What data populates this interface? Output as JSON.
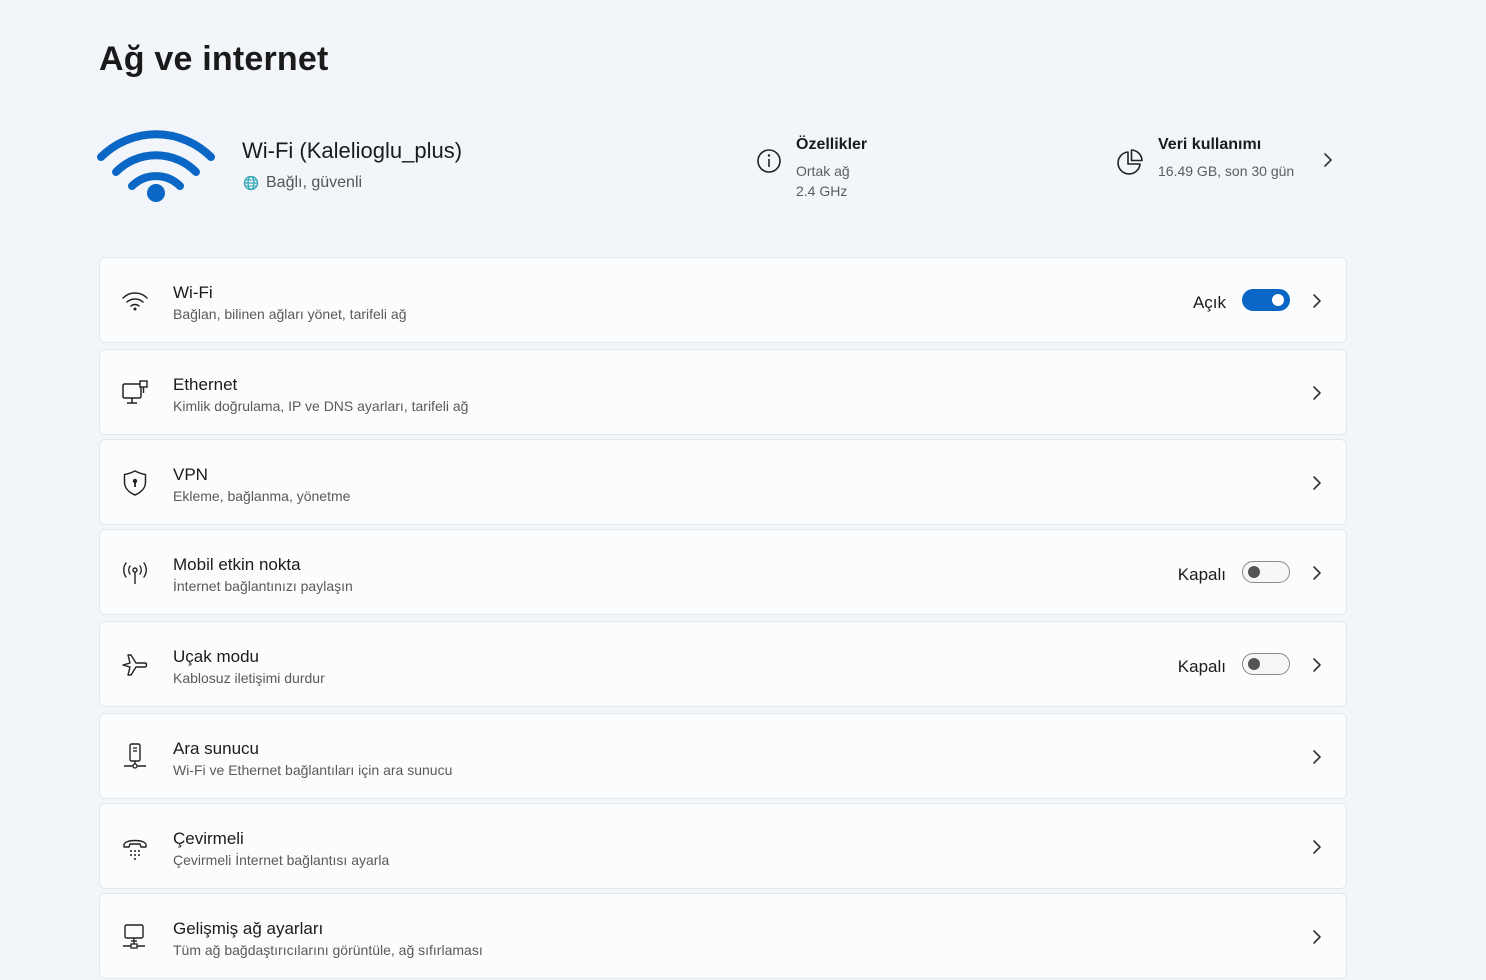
{
  "page": {
    "title": "Ağ ve internet"
  },
  "hero": {
    "network_name": "Wi-Fi (Kalelioglu_plus)",
    "status": "Bağlı, güvenli",
    "properties": {
      "title": "Özellikler",
      "line1": "Ortak ağ",
      "line2": "2.4 GHz"
    },
    "usage": {
      "title": "Veri kullanımı",
      "value": "16.49 GB, son 30 gün"
    }
  },
  "items": [
    {
      "title": "Wi-Fi",
      "subtitle": "Bağlan, bilinen ağları yönet, tarifeli ağ",
      "state": "Açık",
      "icon": "wifi-icon"
    },
    {
      "title": "Ethernet",
      "subtitle": "Kimlik doğrulama, IP ve DNS ayarları, tarifeli ağ",
      "icon": "ethernet-icon"
    },
    {
      "title": "VPN",
      "subtitle": "Ekleme, bağlanma, yönetme",
      "icon": "shield-icon"
    },
    {
      "title": "Mobil etkin nokta",
      "subtitle": "İnternet bağlantınızı paylaşın",
      "state": "Kapalı",
      "icon": "hotspot-icon"
    },
    {
      "title": "Uçak modu",
      "subtitle": "Kablosuz iletişimi durdur",
      "state": "Kapalı",
      "icon": "airplane-icon"
    },
    {
      "title": "Ara sunucu",
      "subtitle": "Wi-Fi ve Ethernet bağlantıları için ara sunucu",
      "icon": "proxy-icon"
    },
    {
      "title": "Çevirmeli",
      "subtitle": "Çevirmeli İnternet bağlantısı ayarla",
      "icon": "dialup-icon"
    },
    {
      "title": "Gelişmiş ağ ayarları",
      "subtitle": "Tüm ağ bağdaştırıcılarını görüntüle, ağ sıfırlaması",
      "icon": "advanced-network-icon"
    }
  ],
  "colors": {
    "accent": "#0a67c5",
    "background": "#f2f5f9",
    "card": "#fbfcfd"
  }
}
